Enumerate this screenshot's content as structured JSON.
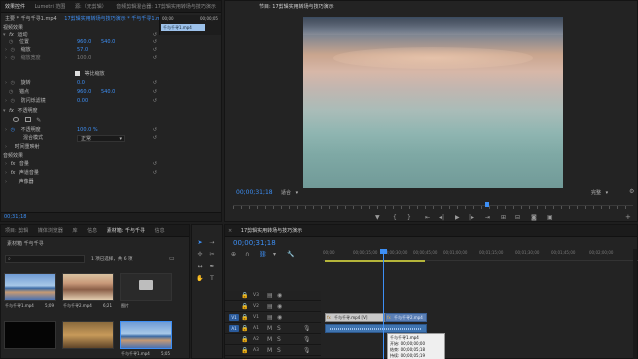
{
  "effect_controls": {
    "tabs": [
      "效果控件",
      "Lumetri 范围",
      "源:（无剪辑）",
      "音频剪辑混合器: 17剪辑实用转场与技巧演示"
    ],
    "clip_path": "主要 * 千与千寻1.mp4",
    "sequence_path": "17剪辑实用转场与技巧演示 * 千与千寻1.mp4",
    "mini_timecode": "00;00",
    "mini_timecode_end": "00;00;05",
    "mini_clip": "千与千寻1.mp4",
    "video_effects_label": "视频效果",
    "motion_label": "运动",
    "position_label": "位置",
    "position_x": "960.0",
    "position_y": "540.0",
    "scale_label": "缩放",
    "scale_value": "57.0",
    "scale_width_label": "缩放宽度",
    "scale_width_value": "100.0",
    "uniform_scale_label": "等比缩放",
    "rotation_label": "旋转",
    "rotation_value": "0.0",
    "anchor_label": "锚点",
    "anchor_x": "960.0",
    "anchor_y": "540.0",
    "antiflicker_label": "防闪烁滤镜",
    "antiflicker_value": "0.00",
    "opacity_group_label": "不透明度",
    "opacity_label": "不透明度",
    "opacity_value": "100.0 %",
    "blend_label": "混合模式",
    "blend_value": "正常",
    "time_remap_label": "时间重映射",
    "audio_effects_label": "音频效果",
    "volume_label": "音量",
    "channel_volume_label": "声道音量",
    "panner_label": "声像器",
    "bottom_timecode": "00;31;18"
  },
  "program_monitor": {
    "title": "节目: 17剪辑实用转场与技巧演示",
    "timecode": "00;00;31;18",
    "fit_label": "适合",
    "quality_label": "完整"
  },
  "project": {
    "tabs": [
      "项目: 剪辑",
      "媒体浏览器",
      "库",
      "信息",
      "素材箱: 千与千寻",
      "信息"
    ],
    "breadcrumb": "素材箱 千与千寻",
    "search_placeholder": "",
    "selection_count": "1 项已选择，共 6 项",
    "items": [
      {
        "label": "千与千寻1.mp4",
        "duration": "5;09"
      },
      {
        "label": "千与千寻2.mp4",
        "duration": "6;21"
      },
      {
        "label": "图片",
        "duration": ""
      },
      {
        "label": "",
        "duration": ""
      },
      {
        "label": "",
        "duration": ""
      },
      {
        "label": "千与千寻1.mp4",
        "duration": "5;05"
      }
    ]
  },
  "timeline": {
    "title": "17剪辑实用转场与技巧演示",
    "timecode": "00;00;31;18",
    "ruler_labels": [
      "00;00",
      "00;00;15;00",
      "00;00;30;00",
      "00;00;45;00",
      "00;01;00;00",
      "00;01;15;00",
      "00;01;30;00",
      "00;01;45;00",
      "00;02;00;00"
    ],
    "video_tracks": [
      "V3",
      "V2",
      "V1"
    ],
    "audio_tracks": [
      "A1",
      "A2",
      "A3"
    ],
    "clip_v1_a": "千与千寻.mp4 [V]",
    "clip_v1_b": "千与千寻2.mp4",
    "tooltip": {
      "name": "千与千寻1.mp4",
      "start": "开始: 00;00;00;00",
      "end": "结束: 00;00;05;18",
      "duration": "持续: 00;00;05;19"
    }
  },
  "colors": {
    "accent": "#3d8ff5",
    "playhead": "#3d8ff5",
    "video_clip": "#5b7fb5",
    "audio_clip": "#3f74b0",
    "background": "#232323"
  }
}
